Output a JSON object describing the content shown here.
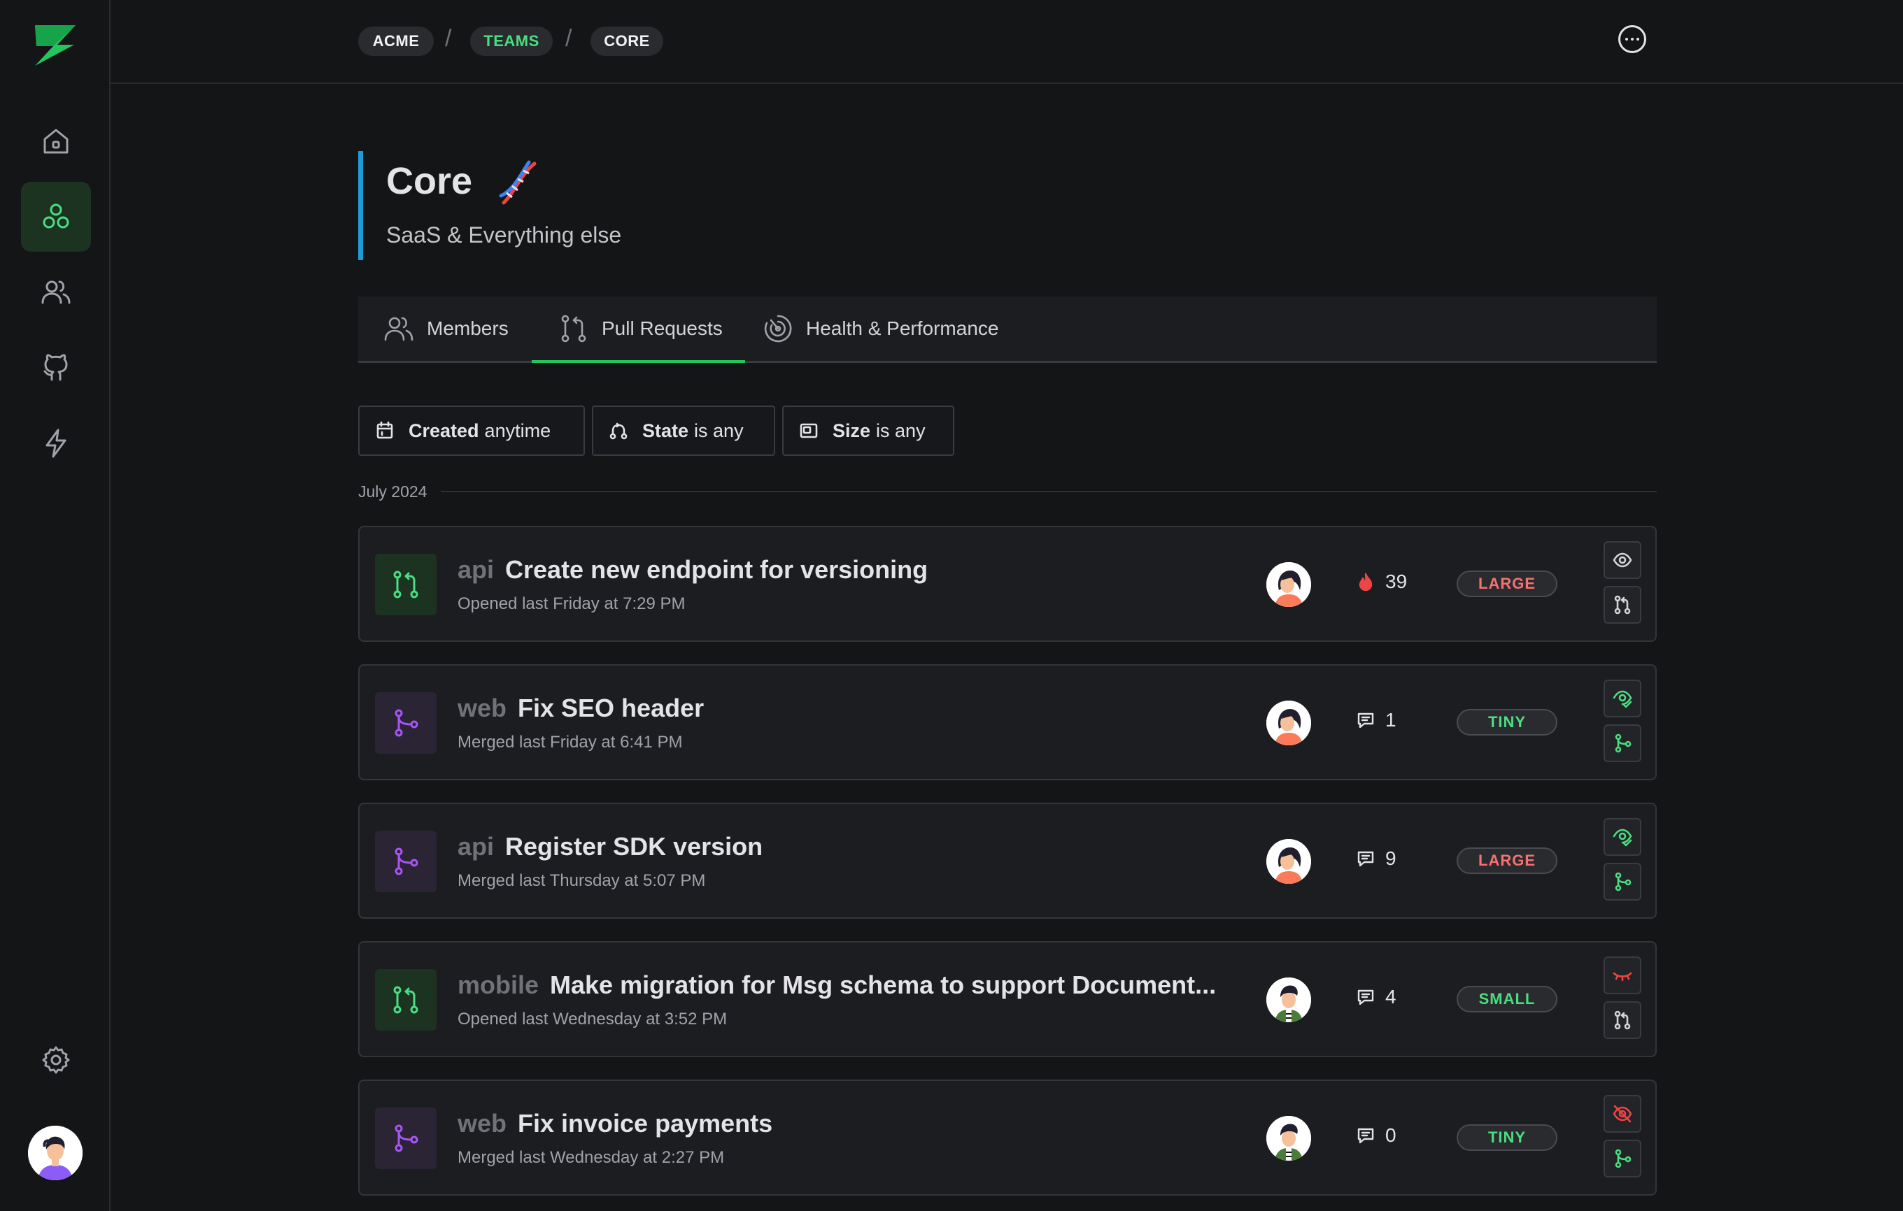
{
  "breadcrumb": [
    "ACME",
    "TEAMS",
    "CORE"
  ],
  "team": {
    "name": "Core",
    "subtitle": "SaaS & Everything else"
  },
  "tabs": [
    {
      "label": "Members",
      "icon": "users-icon"
    },
    {
      "label": "Pull Requests",
      "icon": "pull-request-icon",
      "active": true
    },
    {
      "label": "Health & Performance",
      "icon": "gauge-icon"
    }
  ],
  "filters": [
    {
      "field": "Created",
      "value": "anytime",
      "icon": "calendar-icon"
    },
    {
      "field": "State",
      "value": "is any",
      "icon": "state-icon"
    },
    {
      "field": "Size",
      "value": "is any",
      "icon": "size-icon"
    }
  ],
  "month_label": "July 2024",
  "pull_requests": [
    {
      "repo": "api",
      "title": "Create new endpoint for versioning",
      "meta": "Opened last Friday at 7:29 PM",
      "state": "open",
      "stat_icon": "flame-icon",
      "stat": "39",
      "size": "LARGE",
      "review": "pending",
      "author": "woman"
    },
    {
      "repo": "web",
      "title": "Fix SEO header",
      "meta": "Merged last Friday at 6:41 PM",
      "state": "merged",
      "stat_icon": "comment-icon",
      "stat": "1",
      "size": "TINY",
      "review": "approved",
      "author": "woman"
    },
    {
      "repo": "api",
      "title": "Register SDK version",
      "meta": "Merged last Thursday at 5:07 PM",
      "state": "merged",
      "stat_icon": "comment-icon",
      "stat": "9",
      "size": "LARGE",
      "review": "approved",
      "author": "woman"
    },
    {
      "repo": "mobile",
      "title": "Make migration for Msg schema to support Document...",
      "meta": "Opened last Wednesday at 3:52 PM",
      "state": "open",
      "stat_icon": "comment-icon",
      "stat": "4",
      "size": "SMALL",
      "review": "closed-eye",
      "author": "man"
    },
    {
      "repo": "web",
      "title": "Fix invoice payments",
      "meta": "Merged last Wednesday at 2:27 PM",
      "state": "merged",
      "stat_icon": "comment-icon",
      "stat": "0",
      "size": "TINY",
      "review": "hidden",
      "author": "man"
    }
  ],
  "colors": {
    "accent": "#4ade80",
    "merged": "#a855f7",
    "large": "#f87171",
    "small": "#4ade80",
    "header_bar": "#1e9bd7"
  }
}
